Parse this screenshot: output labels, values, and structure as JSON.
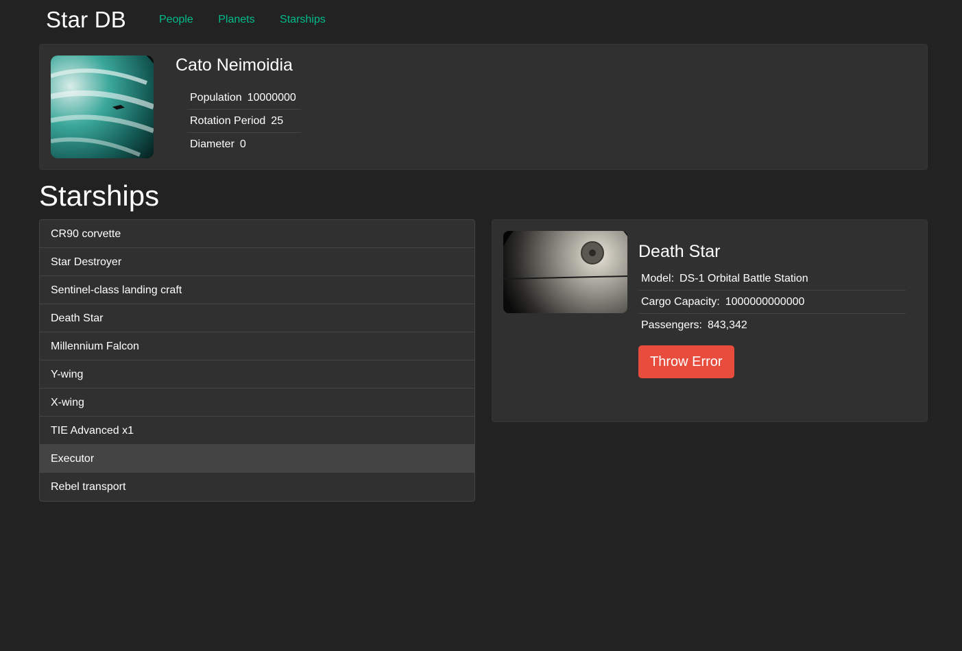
{
  "header": {
    "brand": "Star DB",
    "nav": [
      "People",
      "Planets",
      "Starships"
    ]
  },
  "planet": {
    "name": "Cato Neimoidia",
    "details": [
      {
        "term": "Population",
        "value": "10000000"
      },
      {
        "term": "Rotation Period",
        "value": "25"
      },
      {
        "term": "Diameter",
        "value": "0"
      }
    ]
  },
  "starships": {
    "title": "Starships",
    "items": [
      "CR90 corvette",
      "Star Destroyer",
      "Sentinel-class landing craft",
      "Death Star",
      "Millennium Falcon",
      "Y-wing",
      "X-wing",
      "TIE Advanced x1",
      "Executor",
      "Rebel transport"
    ],
    "active_index": 8
  },
  "ship": {
    "name": "Death Star",
    "details": [
      {
        "term": "Model:",
        "value": "DS-1 Orbital Battle Station"
      },
      {
        "term": "Cargo Capacity:",
        "value": "1000000000000"
      },
      {
        "term": "Passengers:",
        "value": "843,342"
      }
    ],
    "button_label": "Throw Error"
  },
  "colors": {
    "background": "#222222",
    "card": "#303030",
    "accent": "#00bc8c",
    "danger": "#e74c3c",
    "active_item": "#444444"
  }
}
